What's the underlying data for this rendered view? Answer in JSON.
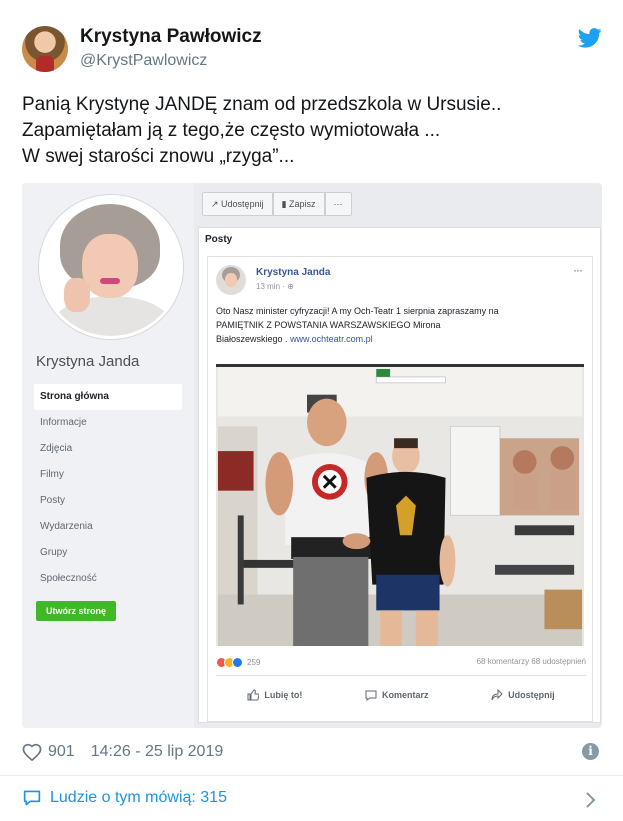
{
  "tweet": {
    "display_name": "Krystyna Pawłowicz",
    "handle": "@KrystPawlowicz",
    "text_lines": [
      "Panią Krystynę JANDĘ znam od przedszkola w Ursusie..",
      "Zapamiętałam ją z tego,że często wymiotowała ...",
      "W swej starości znowu „rzyga”..."
    ],
    "likes": "901",
    "timestamp": "14:26 - 25 lip 2019",
    "talk_label": "Ludzie o tym mówią: 315",
    "accent": "#1da1f2"
  },
  "embedded": {
    "page_name": "Krystyna Janda",
    "nav": [
      "Strona główna",
      "Informacje",
      "Zdjęcia",
      "Filmy",
      "Posty",
      "Wydarzenia",
      "Grupy",
      "Społeczność"
    ],
    "create_page_button": "Utwórz stronę",
    "top_actions": [
      "Udostępnij",
      "Zapisz",
      "···"
    ],
    "posts_heading": "Posty",
    "post": {
      "author": "Krystyna Janda",
      "time": "13 min · ",
      "more": "···",
      "text_line1": "Oto Nasz minister cyfryzacji! A my Och-Teatr 1 sierpnia zapraszamy na",
      "text_line2": "PAMIĘTNIK Z POWSTANIA WARSZAWSKIEGO Mirona",
      "text_line3": "Białoszewskiego .",
      "link": "www.ochteatr.com.pl",
      "reaction_count": "259",
      "stats_right": "68 komentarzy  68 udostępnień",
      "btn_like": "Lubię to!",
      "btn_comment": "Komentarz",
      "btn_share": "Udostępnij"
    }
  }
}
